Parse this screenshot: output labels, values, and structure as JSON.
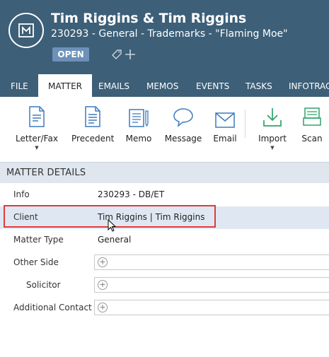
{
  "header": {
    "title": "Tim Riggins & Tim Riggins",
    "subtitle": "230293 - General - Trademarks - \"Flaming Moe\"",
    "status": "OPEN",
    "header_bg": "#3d5f78",
    "status_bg": "#6d91b8"
  },
  "tabs": [
    "FILE",
    "MATTER",
    "EMAILS",
    "MEMOS",
    "EVENTS",
    "TASKS",
    "INFOTRAC"
  ],
  "active_tab": "MATTER",
  "ribbon": {
    "buttons": [
      {
        "label": "Letter/Fax",
        "icon": "letter-fax-icon",
        "dropdown": true
      },
      {
        "label": "Precedent",
        "icon": "precedent-icon"
      },
      {
        "label": "Memo",
        "icon": "memo-icon"
      },
      {
        "label": "Message",
        "icon": "message-icon"
      },
      {
        "label": "Email",
        "icon": "email-icon"
      },
      {
        "label": "Import",
        "icon": "import-icon",
        "dropdown": true
      },
      {
        "label": "Scan",
        "icon": "scan-icon"
      }
    ],
    "icon_color": "#3d7bbf",
    "import_color": "#2fa36b"
  },
  "matter_details": {
    "title": "MATTER DETAILS",
    "rows": [
      {
        "label": "Info",
        "value": "230293 - DB/ET"
      },
      {
        "label": "Client",
        "value": "Tim Riggins | Tim Riggins"
      },
      {
        "label": "Matter Type",
        "value": "General"
      },
      {
        "label": "Other Side",
        "value": ""
      },
      {
        "label": "Solicitor",
        "value": ""
      },
      {
        "label": "Additional Contact",
        "value": ""
      }
    ]
  },
  "highlight_color": "#e03b3b"
}
